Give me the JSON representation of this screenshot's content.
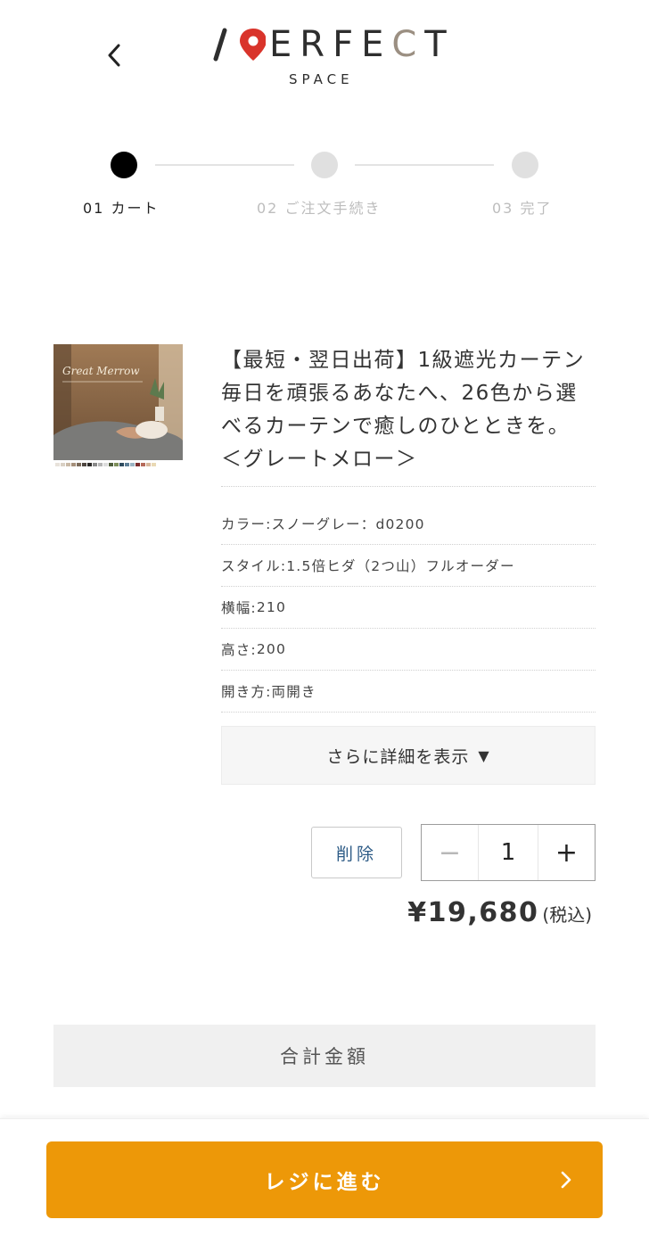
{
  "header": {
    "back_icon": "chevron-left-icon",
    "logo": {
      "main": "PERFECT",
      "sub": "SPACE"
    }
  },
  "stepper": {
    "steps": [
      {
        "label": "01 カート",
        "active": true
      },
      {
        "label": "02 ご注文手続き",
        "active": false
      },
      {
        "label": "03 完了",
        "active": false
      }
    ]
  },
  "product": {
    "image_alt": "Great Merrow",
    "title": "【最短・翌日出荷】1級遮光カーテン 毎日を頑張るあなたへ、26色から選べるカーテンで癒しのひとときを。 ＜グレートメロー＞",
    "specs": [
      {
        "label": "カラー",
        "value": "スノーグレー：d0200"
      },
      {
        "label": "スタイル",
        "value": "1.5倍ヒダ（2つ山）フルオーダー"
      },
      {
        "label": "横幅",
        "value": "210"
      },
      {
        "label": "高さ",
        "value": "200"
      },
      {
        "label": "開き方",
        "value": "両開き"
      }
    ],
    "more_label": "さらに詳細を表示",
    "more_icon": "triangle-down-icon",
    "delete_label": "削除",
    "quantity": "1",
    "minus_symbol": "−",
    "plus_symbol": "+",
    "price": "¥19,680",
    "tax_note": "(税込)"
  },
  "summary": {
    "total_label": "合計金額"
  },
  "footer": {
    "checkout_label": "レジに進む",
    "checkout_icon": "chevron-right-icon",
    "accent_color": "#ed9808"
  }
}
